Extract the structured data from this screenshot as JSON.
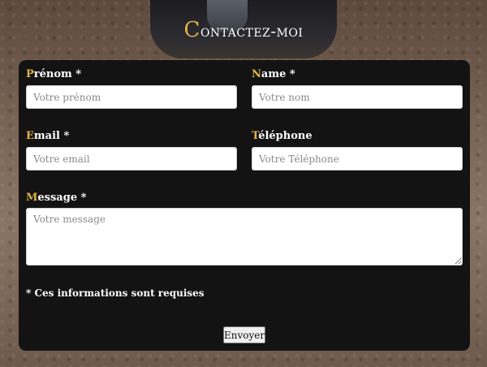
{
  "header": {
    "title_first": "C",
    "title_rest": "ontactez-moi"
  },
  "form": {
    "prenom": {
      "label_first": "P",
      "label_rest": "rénom *",
      "placeholder": "Votre prénom"
    },
    "name": {
      "label_first": "N",
      "label_rest": "ame *",
      "placeholder": "Votre nom"
    },
    "email": {
      "label_first": "E",
      "label_rest": "mail *",
      "placeholder": "Votre email"
    },
    "telephone": {
      "label_first": "T",
      "label_rest": "éléphone",
      "placeholder": "Votre Téléphone"
    },
    "message": {
      "label_first": "M",
      "label_rest": "essage *",
      "placeholder": "Votre message"
    },
    "required_note": "* Ces informations sont requises",
    "submit_label": "Envoyer"
  },
  "colors": {
    "accent": "#e2b24a",
    "card": "#131313",
    "text": "#ffffff"
  }
}
